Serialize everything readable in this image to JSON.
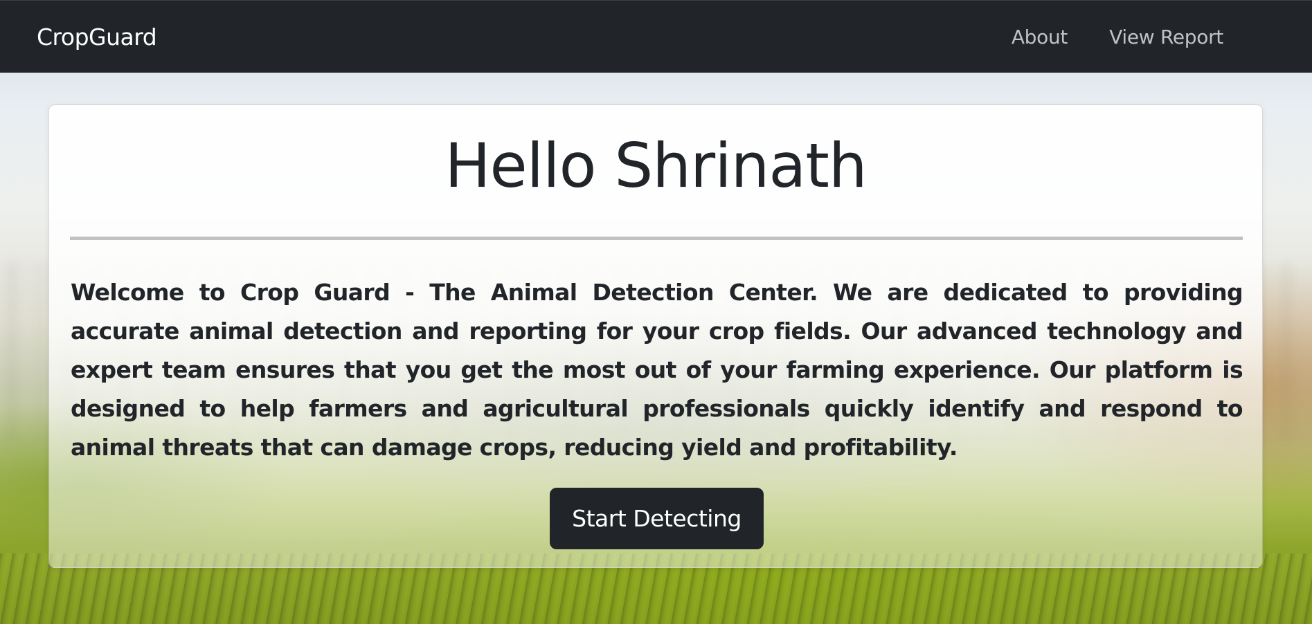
{
  "navbar": {
    "brand": "CropGuard",
    "links": [
      {
        "label": "About"
      },
      {
        "label": "View Report"
      }
    ]
  },
  "card": {
    "title": "Hello Shrinath",
    "description": "Welcome to Crop Guard - The Animal Detection Center. We are dedicated to providing accurate animal detection and reporting for your crop fields. Our advanced technology and expert team ensures that you get the most out of your farming experience. Our platform is designed to help farmers and agricultural professionals quickly identify and respond to animal threats that can damage crops, reducing yield and profitability.",
    "button_label": "Start Detecting"
  },
  "colors": {
    "navbar_bg": "#212529",
    "text_primary": "#212529",
    "button_bg": "#212529",
    "button_text": "#ffffff"
  }
}
